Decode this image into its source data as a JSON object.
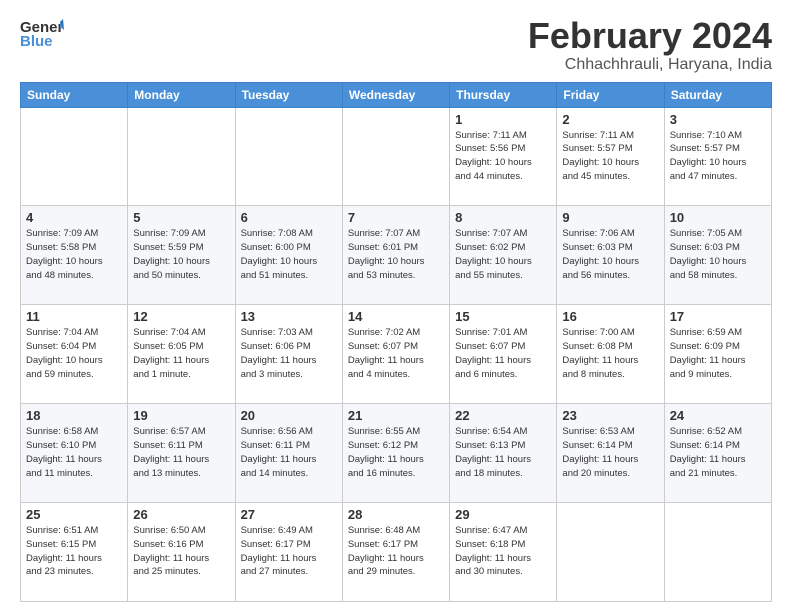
{
  "logo": {
    "line1": "General",
    "line2": "Blue"
  },
  "title": "February 2024",
  "location": "Chhachhrauli, Haryana, India",
  "weekdays": [
    "Sunday",
    "Monday",
    "Tuesday",
    "Wednesday",
    "Thursday",
    "Friday",
    "Saturday"
  ],
  "weeks": [
    [
      {
        "day": "",
        "info": ""
      },
      {
        "day": "",
        "info": ""
      },
      {
        "day": "",
        "info": ""
      },
      {
        "day": "",
        "info": ""
      },
      {
        "day": "1",
        "info": "Sunrise: 7:11 AM\nSunset: 5:56 PM\nDaylight: 10 hours\nand 44 minutes."
      },
      {
        "day": "2",
        "info": "Sunrise: 7:11 AM\nSunset: 5:57 PM\nDaylight: 10 hours\nand 45 minutes."
      },
      {
        "day": "3",
        "info": "Sunrise: 7:10 AM\nSunset: 5:57 PM\nDaylight: 10 hours\nand 47 minutes."
      }
    ],
    [
      {
        "day": "4",
        "info": "Sunrise: 7:09 AM\nSunset: 5:58 PM\nDaylight: 10 hours\nand 48 minutes."
      },
      {
        "day": "5",
        "info": "Sunrise: 7:09 AM\nSunset: 5:59 PM\nDaylight: 10 hours\nand 50 minutes."
      },
      {
        "day": "6",
        "info": "Sunrise: 7:08 AM\nSunset: 6:00 PM\nDaylight: 10 hours\nand 51 minutes."
      },
      {
        "day": "7",
        "info": "Sunrise: 7:07 AM\nSunset: 6:01 PM\nDaylight: 10 hours\nand 53 minutes."
      },
      {
        "day": "8",
        "info": "Sunrise: 7:07 AM\nSunset: 6:02 PM\nDaylight: 10 hours\nand 55 minutes."
      },
      {
        "day": "9",
        "info": "Sunrise: 7:06 AM\nSunset: 6:03 PM\nDaylight: 10 hours\nand 56 minutes."
      },
      {
        "day": "10",
        "info": "Sunrise: 7:05 AM\nSunset: 6:03 PM\nDaylight: 10 hours\nand 58 minutes."
      }
    ],
    [
      {
        "day": "11",
        "info": "Sunrise: 7:04 AM\nSunset: 6:04 PM\nDaylight: 10 hours\nand 59 minutes."
      },
      {
        "day": "12",
        "info": "Sunrise: 7:04 AM\nSunset: 6:05 PM\nDaylight: 11 hours\nand 1 minute."
      },
      {
        "day": "13",
        "info": "Sunrise: 7:03 AM\nSunset: 6:06 PM\nDaylight: 11 hours\nand 3 minutes."
      },
      {
        "day": "14",
        "info": "Sunrise: 7:02 AM\nSunset: 6:07 PM\nDaylight: 11 hours\nand 4 minutes."
      },
      {
        "day": "15",
        "info": "Sunrise: 7:01 AM\nSunset: 6:07 PM\nDaylight: 11 hours\nand 6 minutes."
      },
      {
        "day": "16",
        "info": "Sunrise: 7:00 AM\nSunset: 6:08 PM\nDaylight: 11 hours\nand 8 minutes."
      },
      {
        "day": "17",
        "info": "Sunrise: 6:59 AM\nSunset: 6:09 PM\nDaylight: 11 hours\nand 9 minutes."
      }
    ],
    [
      {
        "day": "18",
        "info": "Sunrise: 6:58 AM\nSunset: 6:10 PM\nDaylight: 11 hours\nand 11 minutes."
      },
      {
        "day": "19",
        "info": "Sunrise: 6:57 AM\nSunset: 6:11 PM\nDaylight: 11 hours\nand 13 minutes."
      },
      {
        "day": "20",
        "info": "Sunrise: 6:56 AM\nSunset: 6:11 PM\nDaylight: 11 hours\nand 14 minutes."
      },
      {
        "day": "21",
        "info": "Sunrise: 6:55 AM\nSunset: 6:12 PM\nDaylight: 11 hours\nand 16 minutes."
      },
      {
        "day": "22",
        "info": "Sunrise: 6:54 AM\nSunset: 6:13 PM\nDaylight: 11 hours\nand 18 minutes."
      },
      {
        "day": "23",
        "info": "Sunrise: 6:53 AM\nSunset: 6:14 PM\nDaylight: 11 hours\nand 20 minutes."
      },
      {
        "day": "24",
        "info": "Sunrise: 6:52 AM\nSunset: 6:14 PM\nDaylight: 11 hours\nand 21 minutes."
      }
    ],
    [
      {
        "day": "25",
        "info": "Sunrise: 6:51 AM\nSunset: 6:15 PM\nDaylight: 11 hours\nand 23 minutes."
      },
      {
        "day": "26",
        "info": "Sunrise: 6:50 AM\nSunset: 6:16 PM\nDaylight: 11 hours\nand 25 minutes."
      },
      {
        "day": "27",
        "info": "Sunrise: 6:49 AM\nSunset: 6:17 PM\nDaylight: 11 hours\nand 27 minutes."
      },
      {
        "day": "28",
        "info": "Sunrise: 6:48 AM\nSunset: 6:17 PM\nDaylight: 11 hours\nand 29 minutes."
      },
      {
        "day": "29",
        "info": "Sunrise: 6:47 AM\nSunset: 6:18 PM\nDaylight: 11 hours\nand 30 minutes."
      },
      {
        "day": "",
        "info": ""
      },
      {
        "day": "",
        "info": ""
      }
    ]
  ]
}
